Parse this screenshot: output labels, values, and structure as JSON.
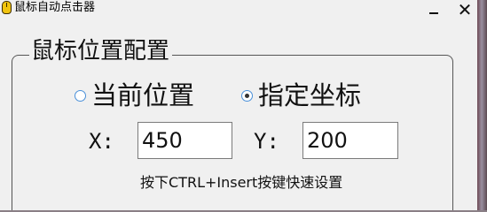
{
  "window": {
    "title": "鼠标自动点击器",
    "minimize_glyph": "–",
    "close_glyph": "✕"
  },
  "group": {
    "title": "鼠标位置配置"
  },
  "position_mode": {
    "options": [
      {
        "label": "当前位置",
        "checked": false
      },
      {
        "label": "指定坐标",
        "checked": true
      }
    ]
  },
  "coordinates": {
    "x_label": "X:",
    "x_value": "450",
    "y_label": "Y:",
    "y_value": "200"
  },
  "hint": "按下CTRL+Insert按键快速设置",
  "icons": {
    "app": "mouse-icon",
    "minimize": "minimize-icon",
    "close": "close-icon"
  }
}
